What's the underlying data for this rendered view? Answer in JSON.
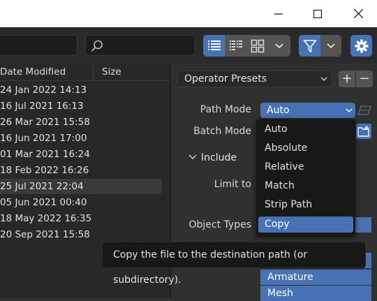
{
  "window": {
    "minimize_icon": "minimize-icon",
    "maximize_icon": "maximize-icon",
    "close_icon": "close-icon"
  },
  "toolbar": {
    "path_value": "",
    "search_value": "",
    "icons": [
      "search-icon",
      "vertical-list-icon",
      "horizontal-list-icon",
      "thumbnails-icon",
      "chevron-down-icon",
      "filter-icon",
      "gear-icon"
    ],
    "accent": "#4772b3"
  },
  "filelist": {
    "columns": [
      "Date Modified",
      "Size"
    ],
    "rows": [
      {
        "date": "24 Jan 2022 14:13",
        "size": ""
      },
      {
        "date": "16 Jul 2021 16:13",
        "size": ""
      },
      {
        "date": "26 Mar 2021 15:58",
        "size": ""
      },
      {
        "date": "16 Jun 2021 17:00",
        "size": ""
      },
      {
        "date": "01 Mar 2021 16:24",
        "size": ""
      },
      {
        "date": "18 Feb 2022 16:26",
        "size": ""
      },
      {
        "date": "25 Jul 2021 22:04",
        "size": "",
        "selected": true
      },
      {
        "date": "05 Jun 2021 00:40",
        "size": ""
      },
      {
        "date": "18 May 2022 16:35",
        "size": ""
      },
      {
        "date": "20 Sep 2021 15:58",
        "size": ""
      }
    ]
  },
  "panel": {
    "presets_label": "Operator Presets",
    "plus": "+",
    "minus": "−",
    "path_mode_label": "Path Mode",
    "path_mode_value": "Auto",
    "batch_mode_label": "Batch Mode",
    "include_label": "Include",
    "limit_to_label": "Limit to",
    "object_types_label": "Object Types",
    "object_types": [
      "Armature",
      "Mesh"
    ]
  },
  "menu": {
    "items": [
      "Auto",
      "Absolute",
      "Relative",
      "Match",
      "Strip Path",
      "Copy"
    ],
    "active": "Copy"
  },
  "tooltip": {
    "text": "Copy the file to the destination path (or subdirectory)."
  }
}
